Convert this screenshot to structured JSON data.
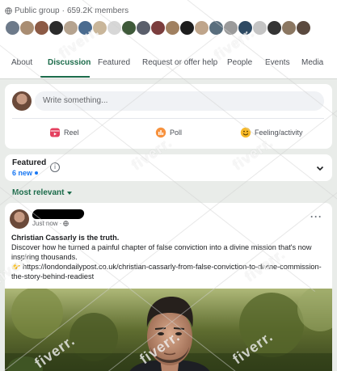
{
  "group": {
    "privacy": "Public group",
    "members": "659.2K members"
  },
  "tabs": [
    {
      "label": "About"
    },
    {
      "label": "Discussion"
    },
    {
      "label": "Featured"
    },
    {
      "label": "Request or offer help"
    },
    {
      "label": "People"
    },
    {
      "label": "Events"
    },
    {
      "label": "Media"
    }
  ],
  "composer": {
    "placeholder": "Write something...",
    "actions": [
      {
        "label": "Reel",
        "icon": "reel-icon"
      },
      {
        "label": "Poll",
        "icon": "poll-icon"
      },
      {
        "label": "Feeling/activity",
        "icon": "feeling-icon"
      }
    ]
  },
  "featured": {
    "title": "Featured",
    "new_count": "6 new"
  },
  "sort": {
    "label": "Most relevant"
  },
  "post": {
    "time": "Just now",
    "headline": "Christian Cassarly is the truth.",
    "body": "Discover how he turned a painful chapter of false conviction into a divine mission that's now inspiring thousands.",
    "link_emoji": "👉",
    "link": "https://londondailypost.co.uk/christian-cassarly-from-false-conviction-to-divine-commission-the-story-behind-readiest"
  },
  "watermark": "fiverr.",
  "colors": {
    "accent": "#1b6b4a",
    "link": "#1877f2",
    "background": "#e9ece9"
  }
}
